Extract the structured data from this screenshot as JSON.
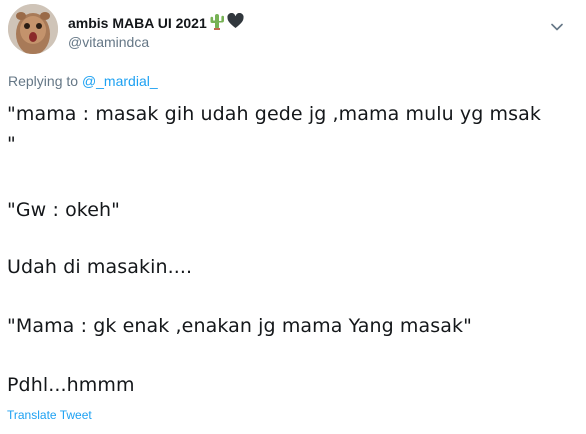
{
  "author": {
    "display_name": "ambis MABA UI 2021",
    "name_emojis": [
      "cactus-icon",
      "black-heart-icon"
    ],
    "handle": "@vitamindca"
  },
  "reply": {
    "prefix": "Replying to ",
    "mention": "@_mardial_"
  },
  "tweet": {
    "lines": [
      "\"mama : masak gih udah gede jg ,mama mulu yg msak",
      "\"",
      "\"Gw : okeh\"",
      "Udah di masakin....",
      "\"Mama : gk enak ,enakan jg mama Yang masak\"",
      "Pdhl...hmmm"
    ]
  },
  "actions": {
    "translate_label": "Translate Tweet"
  },
  "colors": {
    "text": "#14171a",
    "muted": "#657786",
    "link": "#1da1f2"
  }
}
